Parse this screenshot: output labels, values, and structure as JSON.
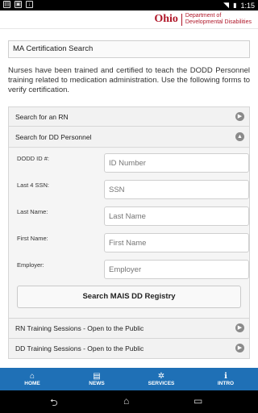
{
  "status_bar": {
    "time": "1:15",
    "left_icons": [
      "sd-card-icon",
      "image-icon",
      "download-icon"
    ],
    "right_icons": [
      "wifi-icon",
      "battery-icon"
    ]
  },
  "header": {
    "brand": "Ohio",
    "dept_line1": "Department of",
    "dept_line2": "Developmental Disabilities",
    "brand_color": "#b0182a"
  },
  "page": {
    "title": "MA Certification Search",
    "intro": "Nurses have been trained and certified to teach the DODD Personnel training related to medication administration. Use the following forms to verify certification."
  },
  "accordion": {
    "rn": {
      "label": "Search for an RN",
      "icon": "chevron-right-circle-icon"
    },
    "dd": {
      "label": "Search for DD Personnel",
      "icon": "chevron-up-circle-icon",
      "fields": [
        {
          "label": "DODD ID #:",
          "placeholder": "ID Number"
        },
        {
          "label": "Last 4 SSN:",
          "placeholder": "SSN"
        },
        {
          "label": "Last Name:",
          "placeholder": "Last Name"
        },
        {
          "label": "First Name:",
          "placeholder": "First Name"
        },
        {
          "label": "Employer:",
          "placeholder": "Employer"
        }
      ],
      "button": "Search MAIS DD Registry"
    },
    "rn_training": {
      "label": "RN Training Sessions - Open to the Public",
      "icon": "chevron-right-circle-icon"
    },
    "dd_training": {
      "label": "DD Training Sessions - Open to the Public",
      "icon": "chevron-right-circle-icon"
    }
  },
  "bottom_nav": [
    {
      "label": "HOME",
      "icon": "home-icon"
    },
    {
      "label": "NEWS",
      "icon": "newspaper-icon"
    },
    {
      "label": "SERVICES",
      "icon": "gear-icon"
    },
    {
      "label": "INTRO",
      "icon": "info-icon"
    }
  ],
  "colors": {
    "nav_bg": "#1f70b6",
    "brand_red": "#b0182a"
  }
}
